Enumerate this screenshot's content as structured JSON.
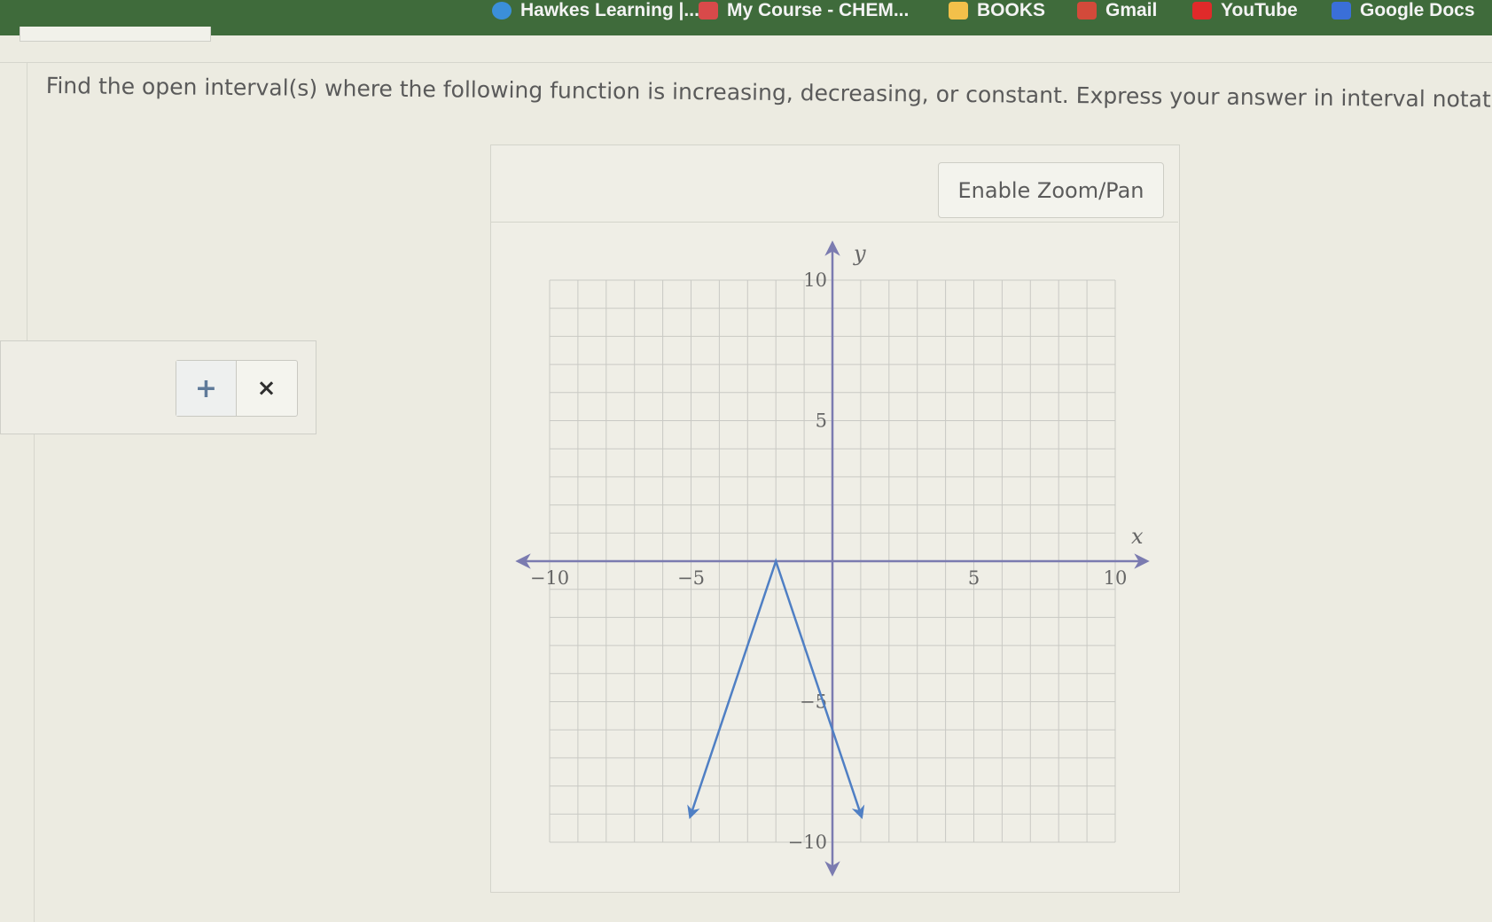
{
  "bookmarks": [
    {
      "label": "Hawkes Learning |...",
      "icon": "hawkes-icon",
      "color": "#3b8fd9"
    },
    {
      "label": "My Course - CHEM...",
      "icon": "course-icon",
      "color": "#d84a4a"
    },
    {
      "label": "BOOKS",
      "icon": "folder-icon",
      "color": "#f3c04a"
    },
    {
      "label": "Gmail",
      "icon": "gmail-icon",
      "color": "#d34a3a"
    },
    {
      "label": "YouTube",
      "icon": "youtube-icon",
      "color": "#e02a2a"
    },
    {
      "label": "Google Docs",
      "icon": "docs-icon",
      "color": "#3a6fd8"
    }
  ],
  "question": {
    "text": "Find the open interval(s) where the following function is increasing, decreasing, or constant. Express your answer in interval notation."
  },
  "answer_controls": {
    "add_label": "+",
    "remove_label": "×"
  },
  "graph_panel": {
    "zoom_button_label": "Enable Zoom/Pan"
  },
  "colors": {
    "function_line": "#4f7fc4",
    "axis": "#7b7bb0",
    "grid": "#c9c9c4"
  },
  "chart_data": {
    "type": "line",
    "xlabel": "x",
    "ylabel": "y",
    "xlim": [
      -10,
      10
    ],
    "ylim": [
      -10,
      10
    ],
    "x_ticks": [
      -10,
      -5,
      5,
      10
    ],
    "y_ticks": [
      10,
      5,
      -5,
      -10
    ],
    "x_tick_labels": [
      "−10",
      "−5",
      "5",
      "10"
    ],
    "y_tick_labels": [
      "10",
      "5",
      "−5",
      "−10"
    ],
    "grid": true,
    "series": [
      {
        "x": [
          -5,
          -2,
          1
        ],
        "y": [
          -9,
          0,
          -9
        ],
        "arrows": [
          "start",
          "end"
        ]
      }
    ]
  }
}
